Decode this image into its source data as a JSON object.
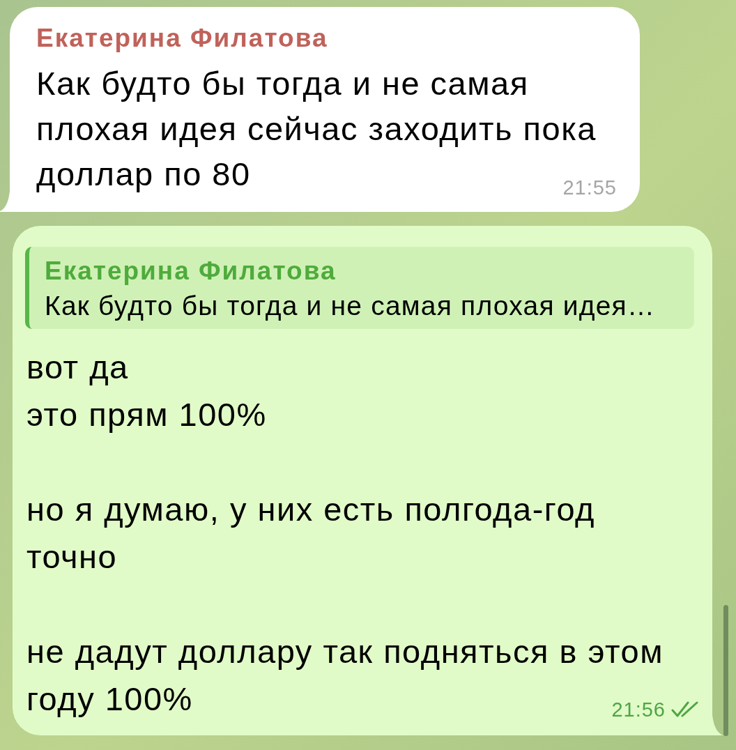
{
  "messages": [
    {
      "kind": "incoming",
      "sender": "Екатерина Филатова",
      "paragraphs": [
        [
          "Как будто бы тогда и не самая",
          "плохая идея сейчас заходить пока",
          "доллар по 80"
        ]
      ],
      "time": "21:55"
    },
    {
      "kind": "outgoing",
      "reply": {
        "sender": "Екатерина Филатова",
        "text": "Как будто бы тогда и не самая плохая идея…"
      },
      "paragraphs": [
        [
          "вот да",
          "это прям 100%"
        ],
        [
          "но я думаю, у них есть полгода-год",
          "точно"
        ],
        [
          "не дадут доллару так подняться в этом",
          "году 100%"
        ]
      ],
      "time": "21:56",
      "read": true
    }
  ]
}
